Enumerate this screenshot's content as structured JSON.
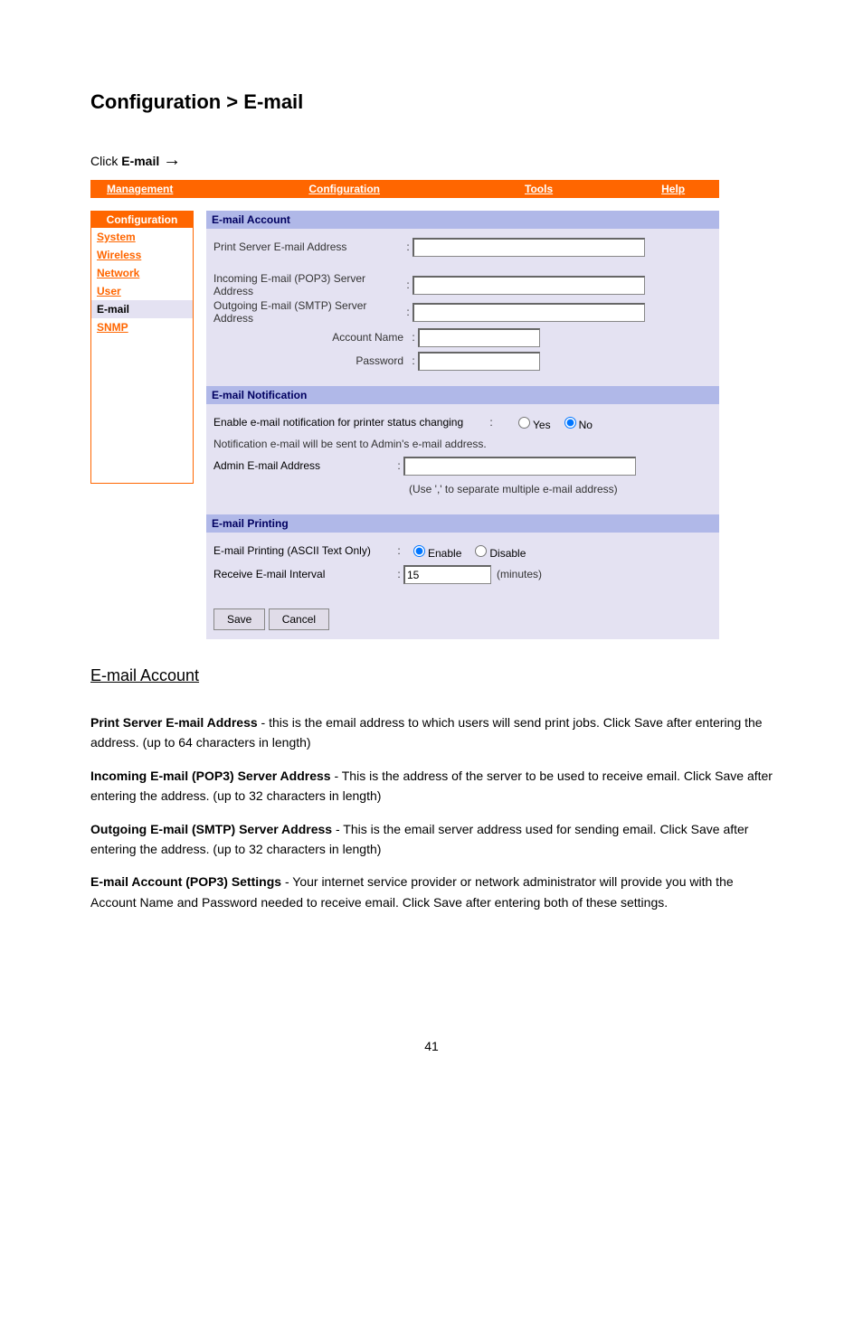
{
  "docHeading": "Configuration > E-mail",
  "docIntroLine1": "Click",
  "docIntroBold1": "E-mail",
  "docIntroArrow": "→",
  "topnav": {
    "management": "Management",
    "config": "Configuration",
    "tools": "Tools",
    "help": "Help"
  },
  "sidebar": {
    "title": "Configuration",
    "items": [
      {
        "label": "System",
        "active": false
      },
      {
        "label": "Wireless",
        "active": false
      },
      {
        "label": "Network",
        "active": false
      },
      {
        "label": "User",
        "active": false
      },
      {
        "label": "E-mail",
        "active": true
      },
      {
        "label": "SNMP",
        "active": false
      }
    ]
  },
  "sections": {
    "account": {
      "title": "E-mail Account",
      "printServerLabel": "Print Server E-mail Address",
      "incomingLabel": "Incoming E-mail (POP3) Server Address",
      "outgoingLabel": "Outgoing E-mail (SMTP) Server Address",
      "accountNameLabel": "Account Name",
      "passwordLabel": "Password"
    },
    "notification": {
      "title": "E-mail Notification",
      "enableLabel": "Enable e-mail notification for printer status changing",
      "yes": "Yes",
      "no": "No",
      "note": "Notification e-mail will be sent to Admin's e-mail address.",
      "adminLabel": "Admin E-mail Address",
      "hint": "(Use ',' to separate multiple e-mail address)"
    },
    "printing": {
      "title": "E-mail Printing",
      "asciiLabel": "E-mail Printing (ASCII Text Only)",
      "enable": "Enable",
      "disable": "Disable",
      "intervalLabel": "Receive E-mail Interval",
      "intervalValue": "15",
      "intervalUnit": "(minutes)"
    }
  },
  "buttons": {
    "save": "Save",
    "cancel": "Cancel"
  },
  "sectionUnderlineTitle": "E-mail Account",
  "bodyParagraphs": [
    {
      "bold": "Print Server E-mail Address",
      "text": " - this is the email address to which users will send print jobs. Click Save after entering the address. (up to 64 characters in length)"
    },
    {
      "bold": "Incoming E-mail (POP3) Server Address",
      "text": " - This is the address of the server to be used to receive email. Click Save after entering the address. (up to 32 characters in length)"
    },
    {
      "bold": "Outgoing E-mail (SMTP) Server Address",
      "text": " - This is the email server address used for sending email. Click Save after entering the address. (up to 32 characters in length)"
    },
    {
      "bold": "E-mail Account (POP3) Settings",
      "text": " - Your internet service provider or network administrator will provide you with the Account Name and Password needed to receive email. Click Save after entering both of these settings."
    }
  ],
  "pageNumber": "41"
}
